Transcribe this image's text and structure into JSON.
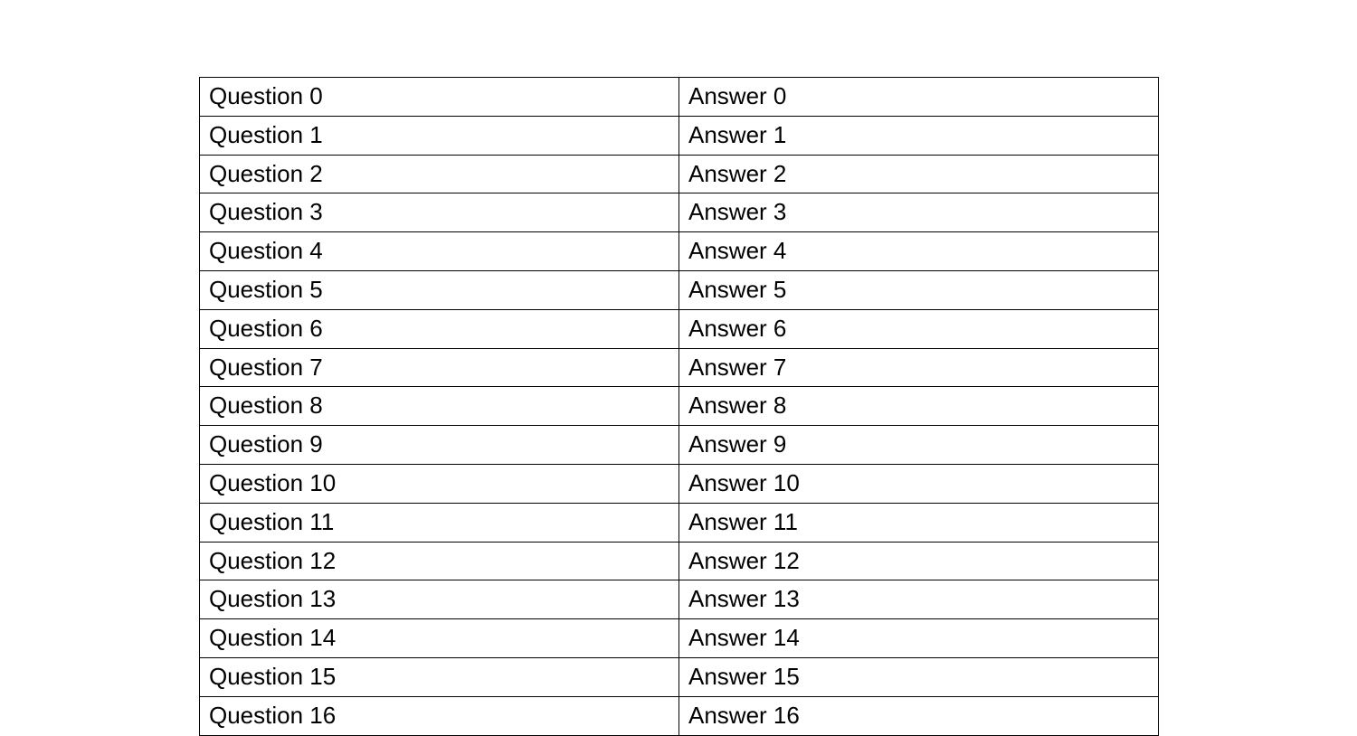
{
  "table": {
    "rows": [
      {
        "question": "Question 0",
        "answer": "Answer 0"
      },
      {
        "question": "Question 1",
        "answer": "Answer 1"
      },
      {
        "question": "Question 2",
        "answer": "Answer 2"
      },
      {
        "question": "Question 3",
        "answer": "Answer 3"
      },
      {
        "question": "Question 4",
        "answer": "Answer 4"
      },
      {
        "question": "Question 5",
        "answer": "Answer 5"
      },
      {
        "question": "Question 6",
        "answer": "Answer 6"
      },
      {
        "question": "Question 7",
        "answer": "Answer 7"
      },
      {
        "question": "Question 8",
        "answer": "Answer 8"
      },
      {
        "question": "Question 9",
        "answer": "Answer 9"
      },
      {
        "question": "Question 10",
        "answer": "Answer 10"
      },
      {
        "question": "Question 11",
        "answer": "Answer 11"
      },
      {
        "question": "Question 12",
        "answer": "Answer 12"
      },
      {
        "question": "Question 13",
        "answer": "Answer 13"
      },
      {
        "question": "Question 14",
        "answer": "Answer 14"
      },
      {
        "question": "Question 15",
        "answer": "Answer 15"
      },
      {
        "question": "Question 16",
        "answer": "Answer 16"
      }
    ]
  }
}
